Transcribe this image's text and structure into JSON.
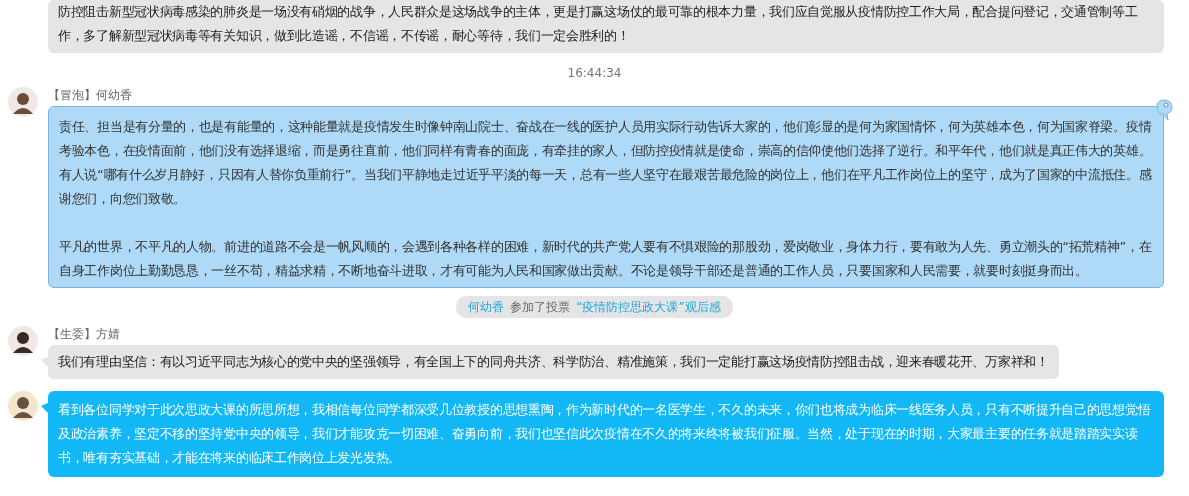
{
  "messages": [
    {
      "kind": "plain",
      "avatar": false,
      "paragraphs": [
        "防控阻击新型冠状病毒感染的肺炎是一场没有硝烟的战争，人民群众是这场战争的主体，更是打赢这场仗的最可靠的根本力量，我们应自觉服从疫情防控工作大局，配合提问登记，交通管制等工作，多了解新型冠状病毒等有关知识，做到比造谣，不信谣，不传谣，耐心等待，我们一定会胜利的！"
      ]
    },
    {
      "kind": "time",
      "text": "16:44:34"
    },
    {
      "kind": "themed",
      "avatar": true,
      "sender": "【冒泡】何幼香",
      "paragraphs": [
        "责任、担当是有分量的，也是有能量的，这种能量就是疫情发生时像钟南山院士、奋战在一线的医护人员用实际行动告诉大家的，他们彰显的是何为家国情怀，何为英雄本色，何为国家脊梁。疫情考验本色，在疫情面前，他们没有选择退缩，而是勇往直前，他们同样有青春的面庞，有牵挂的家人，但防控疫情就是使命，崇高的信仰使他们选择了逆行。和平年代，他们就是真正伟大的英雄。有人说“哪有什么岁月静好，只因有人替你负重前行”。当我们平静地走过近乎平淡的每一天，总有一些人坚守在最艰苦最危险的岗位上，他们在平凡工作岗位上的坚守，成为了国家的中流抵住。感谢您们，向您们致敬。",
        "平凡的世界，不平凡的人物。前进的道路不会是一帆风顺的，会遇到各种各样的困难，新时代的共产党人要有不惧艰险的那股劲，爱岗敬业，身体力行，要有敢为人先、勇立潮头的“拓荒精神”，在自身工作岗位上勤勤恳恳，一丝不苟，精益求精，不断地奋斗进取，才有可能为人民和国家做出贡献。不论是领导干部还是普通的工作人员，只要国家和人民需要，就要时刻挺身而出。"
      ]
    },
    {
      "kind": "notice",
      "actor": "何幼香",
      "action": "参加了投票",
      "target": "“疫情防控思政大课”观后感"
    },
    {
      "kind": "plain",
      "avatar": true,
      "sender": "【生委】方婧",
      "paragraphs": [
        "我们有理由坚信：有以习近平同志为核心的党中央的坚强领导，有全国上下的同舟共济、科学防治、精准施策，我们一定能打赢这场疫情防控阻击战，迎来春暖花开、万家祥和！"
      ]
    },
    {
      "kind": "own",
      "avatar": true,
      "paragraphs": [
        "看到各位同学对于此次思政大课的所思所想，我相信每位同学都深受几位教授的思想熏陶，作为新时代的一名医学生，不久的未来，你们也将成为临床一线医务人员，只有不断提升自己的思想觉悟及政治素养，坚定不移的坚持党中央的领导，我们才能攻克一切困难、奋勇向前，我们也坚信此次疫情在不久的将来终将被我们征服。当然，处于现在的时期，大家最主要的任务就是踏踏实实读书，唯有夯实基础，才能在将来的临床工作岗位上发光发热。"
      ]
    }
  ]
}
